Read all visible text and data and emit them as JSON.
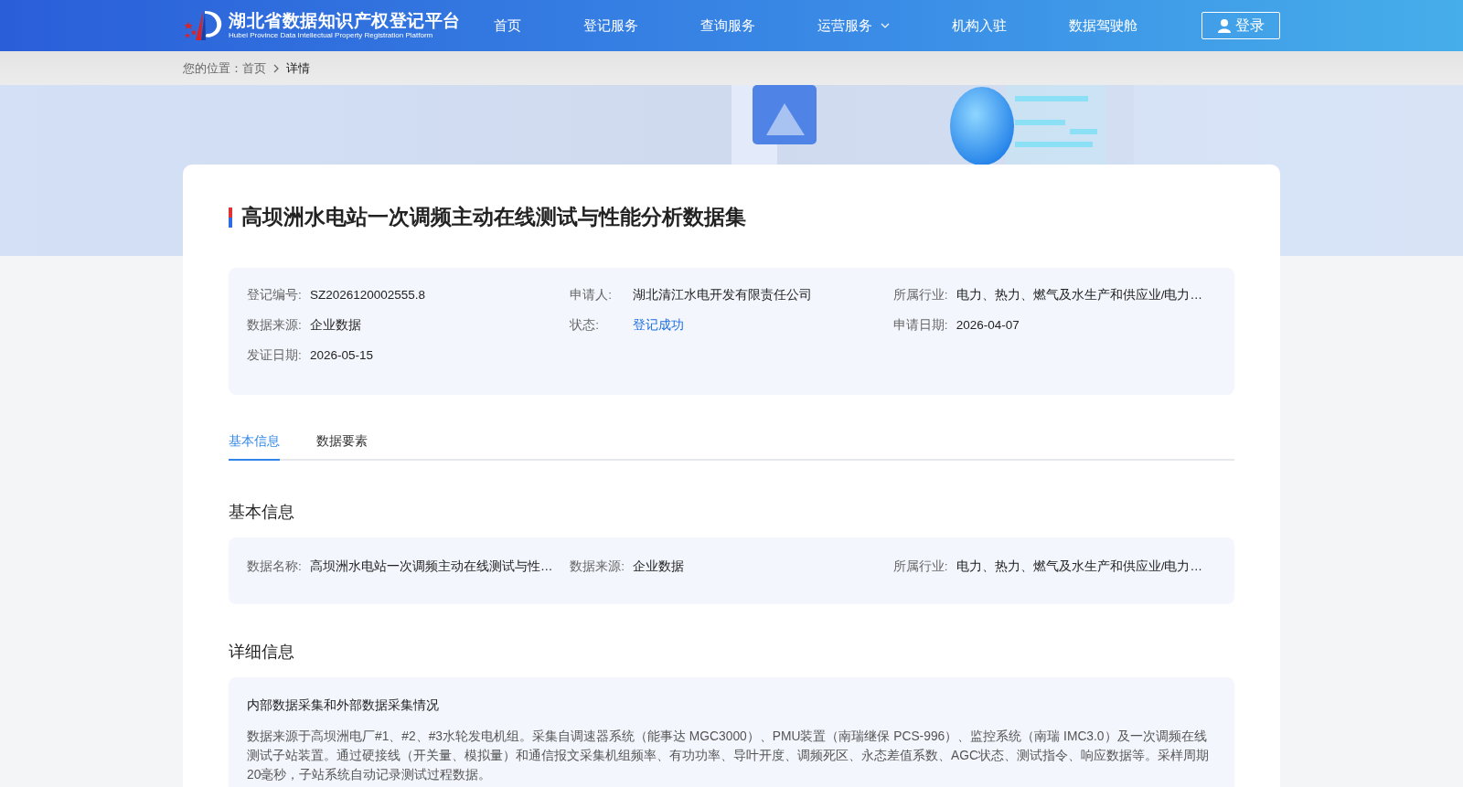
{
  "header": {
    "logo_title": "湖北省数据知识产权登记平台",
    "logo_subtitle": "Hubei Province Data Intellectual Property Registration Platform",
    "nav": [
      {
        "label": "首页",
        "dropdown": false
      },
      {
        "label": "登记服务",
        "dropdown": false
      },
      {
        "label": "查询服务",
        "dropdown": false
      },
      {
        "label": "运营服务",
        "dropdown": true
      },
      {
        "label": "机构入驻",
        "dropdown": false
      },
      {
        "label": "数据驾驶舱",
        "dropdown": false
      }
    ],
    "login": "登录"
  },
  "breadcrumb": {
    "prefix": "您的位置：",
    "items": [
      {
        "label": "首页",
        "current": false
      },
      {
        "label": "详情",
        "current": true
      }
    ]
  },
  "title": "高坝洲水电站一次调频主动在线测试与性能分析数据集",
  "summary": [
    {
      "label": "登记编号:",
      "value": "SZ2026120002555.8",
      "kind": "text"
    },
    {
      "label": "申请人:",
      "value": "湖北清江水电开发有限责任公司",
      "kind": "text"
    },
    {
      "label": "所属行业:",
      "value": "电力、热力、燃气及水生产和供应业/电力…",
      "kind": "text"
    },
    {
      "label": "数据来源:",
      "value": "企业数据",
      "kind": "text"
    },
    {
      "label": "状态:",
      "value": "登记成功",
      "kind": "status"
    },
    {
      "label": "申请日期:",
      "value": "2026-04-07",
      "kind": "text"
    },
    {
      "label": "发证日期:",
      "value": "2026-05-15",
      "kind": "text"
    }
  ],
  "tabs": [
    {
      "label": "基本信息",
      "selected": true
    },
    {
      "label": "数据要素",
      "selected": false
    }
  ],
  "basic_info": {
    "heading": "基本信息",
    "fields": [
      {
        "label": "数据名称:",
        "value": "高坝洲水电站一次调频主动在线测试与性…"
      },
      {
        "label": "数据来源:",
        "value": "企业数据"
      },
      {
        "label": "所属行业:",
        "value": "电力、热力、燃气及水生产和供应业/电力…"
      }
    ]
  },
  "detail_info": {
    "heading": "详细信息",
    "subtitle": "内部数据采集和外部数据采集情况",
    "text": "数据来源于高坝洲电厂#1、#2、#3水轮发电机组。采集自调速器系统（能事达 MGC3000）、PMU装置（南瑞继保 PCS-996）、监控系统（南瑞 IMC3.0）及一次调频在线测试子站装置。通过硬接线（开关量、模拟量）和通信报文采集机组频率、有功功率、导叶开度、调频死区、永态差值系数、AGC状态、测试指令、响应数据等。采样周期20毫秒，子站系统自动记录测试过程数据。"
  }
}
